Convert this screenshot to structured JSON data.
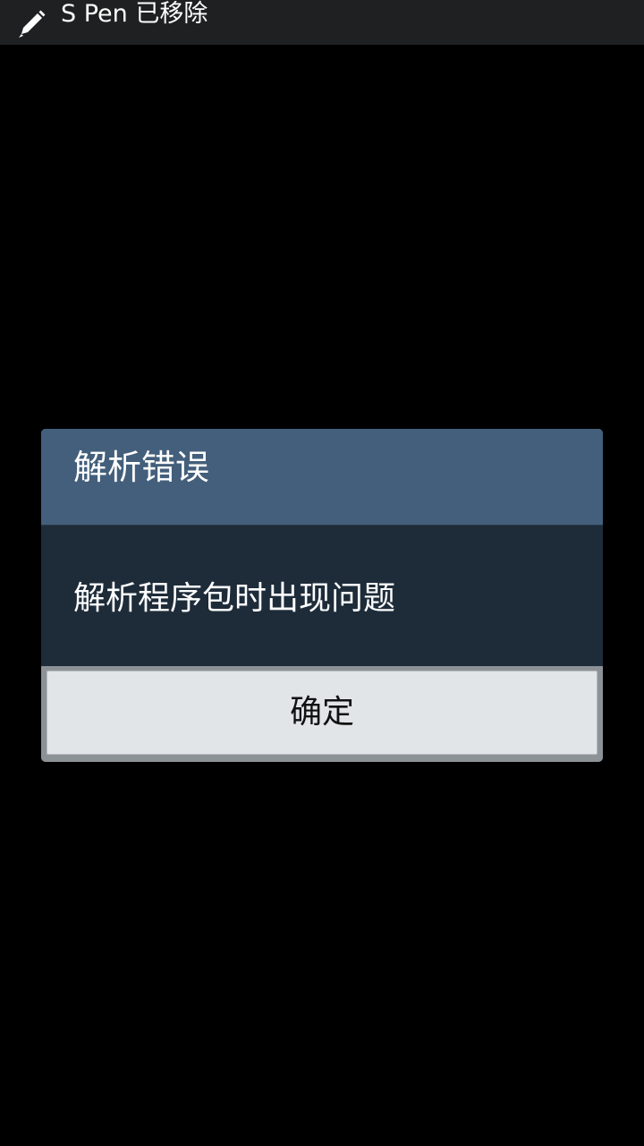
{
  "status_bar": {
    "icon": "pen-icon",
    "notification_text": "S Pen 已移除"
  },
  "dialog": {
    "title": "解析错误",
    "message": "解析程序包时出现问题",
    "ok_button_label": "确定"
  },
  "colors": {
    "status_bar_bg": "#1f2021",
    "dialog_header_bg": "#435f7b",
    "dialog_body_bg": "#1e2c3a",
    "button_bg": "#e1e5e8",
    "background": "#000000"
  }
}
